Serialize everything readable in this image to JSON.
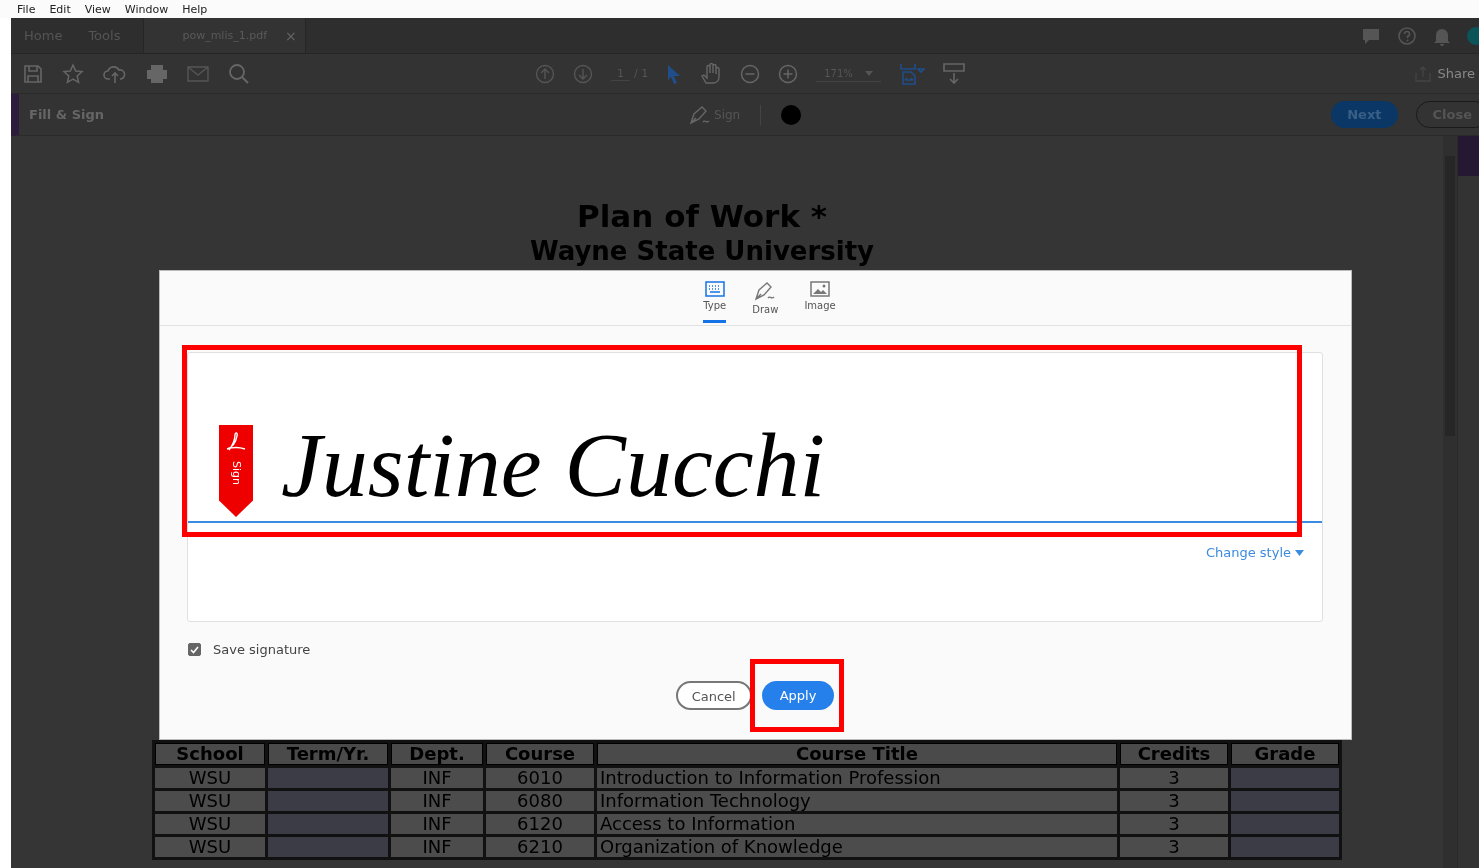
{
  "menu": [
    "File",
    "Edit",
    "View",
    "Window",
    "Help"
  ],
  "tabs": [
    {
      "label": "Home",
      "selected": false
    },
    {
      "label": "Tools",
      "selected": false
    },
    {
      "label": "pow_mlis_1.pdf",
      "selected": true
    }
  ],
  "tab_close": "×",
  "toolbar": {
    "page": "1",
    "page_total": "/ 1",
    "zoom": "171%",
    "share": "Share"
  },
  "fill_sign": {
    "title": "Fill & Sign",
    "sign": "Sign",
    "next": "Next",
    "close": "Close"
  },
  "document": {
    "title": "Plan of Work *",
    "subtitle": "Wayne State University",
    "columns": [
      "School",
      "Term/Yr.",
      "Dept.",
      "Course",
      "Course Title",
      "Credits",
      "Grade"
    ],
    "rows": [
      [
        "WSU",
        "",
        "INF",
        "6010",
        "Introduction to Information Profession",
        "3",
        ""
      ],
      [
        "WSU",
        "",
        "INF",
        "6080",
        "Information Technology",
        "3",
        ""
      ],
      [
        "WSU",
        "",
        "INF",
        "6120",
        "Access to Information",
        "3",
        ""
      ],
      [
        "WSU",
        "",
        "INF",
        "6210",
        "Organization of Knowledge",
        "3",
        ""
      ]
    ]
  },
  "dialog": {
    "tabs": [
      {
        "label": "Type",
        "selected": true
      },
      {
        "label": "Draw",
        "selected": false
      },
      {
        "label": "Image",
        "selected": false
      }
    ],
    "flag_label": "Sign",
    "signature": "Justine Cucchi",
    "signature_highlighted": true,
    "change_style": "Change style",
    "save_signature": {
      "label": "Save signature",
      "checked": true
    },
    "buttons": [
      {
        "label": "Cancel",
        "kind": "secondary",
        "highlighted": false
      },
      {
        "label": "Apply",
        "kind": "primary",
        "highlighted": true
      }
    ]
  }
}
